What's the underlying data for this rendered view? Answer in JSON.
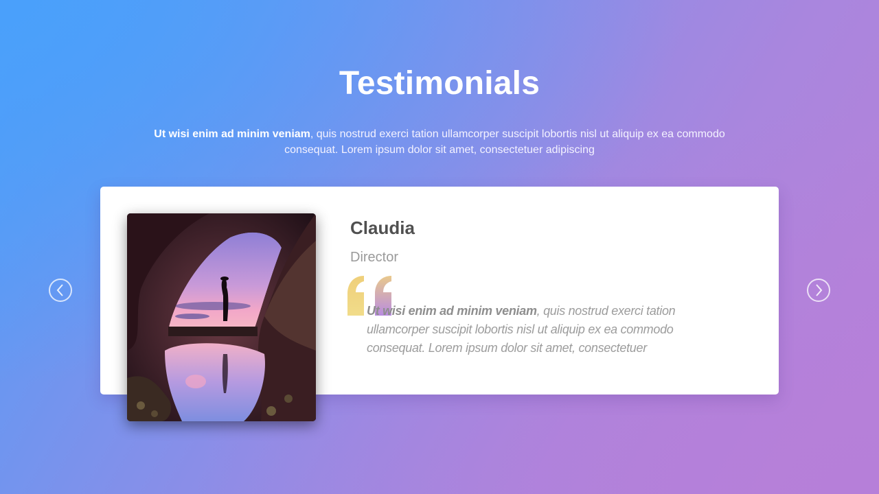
{
  "header": {
    "title": "Testimonials",
    "intro_bold": "Ut wisi enim ad minim veniam",
    "intro_rest": ", quis nostrud exerci tation ullamcorper suscipit lobortis nisl ut aliquip ex ea commodo consequat. Lorem ipsum dolor sit amet, consectetuer adipiscing"
  },
  "testimonial": {
    "name": "Claudia",
    "role": "Director",
    "quote_bold": "Ut wisi enim ad minim veniam",
    "quote_rest": ", quis nostrud exerci tation ullamcorper suscipit lobortis nisl ut aliquip ex ea commodo consequat. Lorem ipsum dolor sit amet, consectetuer",
    "photo": "cave-silhouette-photo"
  },
  "navigation": {
    "prev_icon": "chevron-left-icon",
    "next_icon": "chevron-right-icon"
  },
  "colors": {
    "gradient_start": "#4f9ef8",
    "gradient_end": "#b881d8",
    "quote_gold": "#efd27a",
    "quote_violet": "#b98ce0"
  }
}
